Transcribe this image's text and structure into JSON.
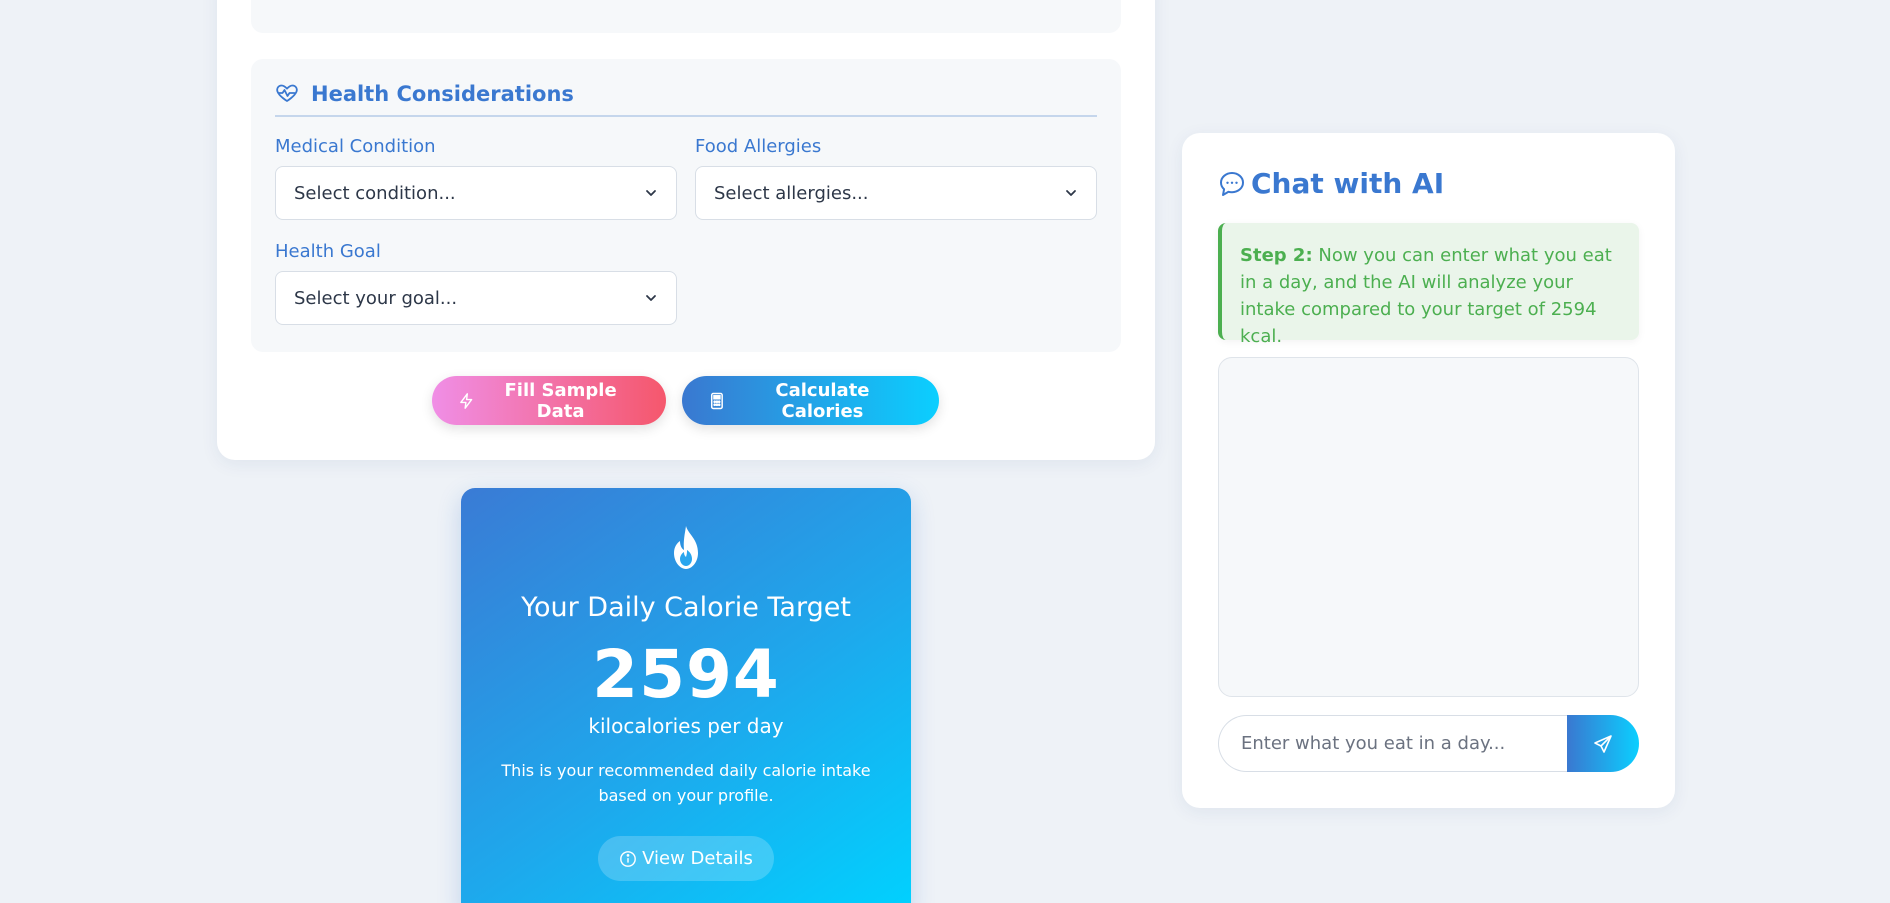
{
  "health": {
    "title": "Health Considerations",
    "medical_label": "Medical Condition",
    "medical_value": "Select condition...",
    "allergies_label": "Food Allergies",
    "allergies_value": "Select allergies...",
    "goal_label": "Health Goal",
    "goal_value": "Select your goal..."
  },
  "actions": {
    "fill_sample": "Fill Sample Data",
    "calculate": "Calculate Calories"
  },
  "calorie": {
    "title": "Your Daily Calorie Target",
    "value": "2594",
    "unit": "kilocalories per day",
    "description": "This is your recommended daily calorie intake based on your profile.",
    "view_details": "View Details"
  },
  "chat": {
    "title": "Chat with AI",
    "step_label": "Step 2:",
    "step_text": " Now you can enter what you eat in a day, and the AI will analyze your intake compared to your target of 2594 kcal.",
    "input_placeholder": "Enter what you eat in a day..."
  },
  "icons": {
    "heart_pulse": "heart-pulse-icon",
    "chevron": "chevron-down-icon",
    "bolt": "bolt-icon",
    "calculator": "calculator-icon",
    "flame": "flame-icon",
    "info": "info-icon",
    "chat": "chat-bubble-icon",
    "send": "send-icon"
  },
  "colors": {
    "accent": "#3a78d0",
    "accent_light": "#0bcfff",
    "pink": "#f08ee6",
    "red": "#f5576c",
    "success": "#4caf50",
    "background": "#eef2f7"
  }
}
